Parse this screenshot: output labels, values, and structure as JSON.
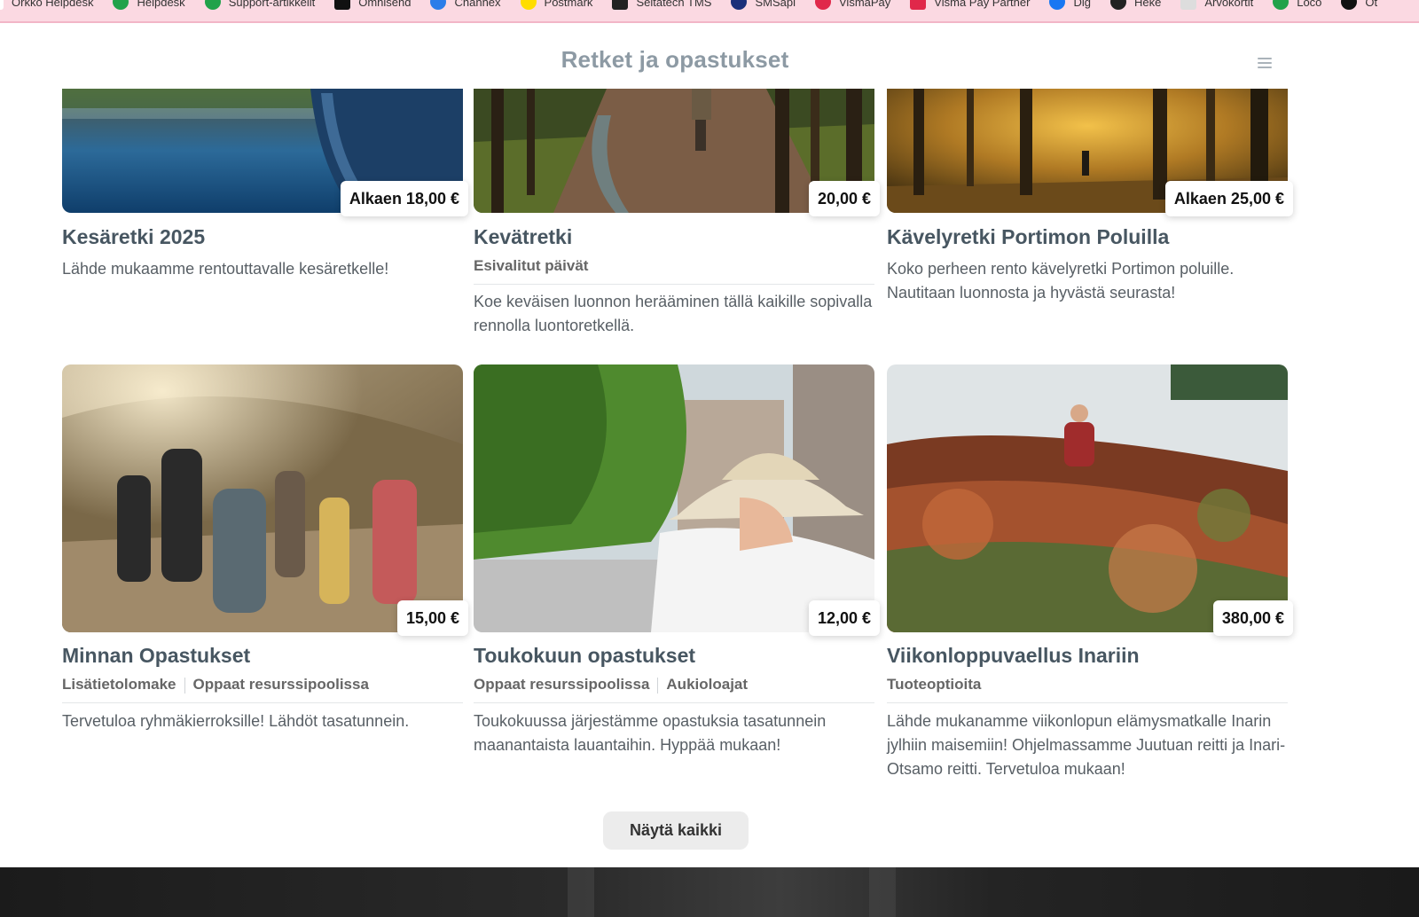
{
  "bookmarks": [
    {
      "label": "Orkko Helpdesk",
      "color": "#ffffff",
      "icon": "orkko-icon"
    },
    {
      "label": "Helpdesk",
      "color": "#21a24a",
      "icon": "helpdesk-icon"
    },
    {
      "label": "Support-artikkelit",
      "color": "#21a24a",
      "icon": "support-icon"
    },
    {
      "label": "Omnisend",
      "color": "#111111",
      "icon": "omnisend-icon"
    },
    {
      "label": "Channex",
      "color": "#2b7de9",
      "icon": "channex-icon"
    },
    {
      "label": "Postmark",
      "color": "#ffdd00",
      "icon": "postmark-icon"
    },
    {
      "label": "Seitatech TMS",
      "color": "#222222",
      "icon": "seitatech-icon"
    },
    {
      "label": "SMSapi",
      "color": "#1a2f7a",
      "icon": "smsapi-icon"
    },
    {
      "label": "VismaPay",
      "color": "#e0284a",
      "icon": "vismapay-icon"
    },
    {
      "label": "Visma Pay Partner",
      "color": "#e0284a",
      "icon": "vismapay-partner-icon"
    },
    {
      "label": "Dig",
      "color": "#1877f2",
      "icon": "dig-icon"
    },
    {
      "label": "Heke",
      "color": "#222222",
      "icon": "heke-icon"
    },
    {
      "label": "Arvokortit",
      "color": "#dddddd",
      "icon": "arvokortit-icon"
    },
    {
      "label": "Loco",
      "color": "#21a24a",
      "icon": "loco-icon"
    },
    {
      "label": "Ot",
      "color": "#111111",
      "icon": "ot-icon"
    }
  ],
  "header": {
    "title": "Retket ja opastukset"
  },
  "cards": [
    {
      "title": "Kesäretki 2025",
      "price": "Alkaen 18,00 €",
      "tags": [],
      "description": "Lähde mukaamme rentouttavalle kesäretkelle!"
    },
    {
      "title": "Kevätretki",
      "price": "20,00 €",
      "tags": [
        "Esivalitut päivät"
      ],
      "description": "Koe keväisen luonnon herääminen tällä kaikille sopivalla rennolla luontoretkellä."
    },
    {
      "title": "Kävelyretki Portimon Poluilla",
      "price": "Alkaen 25,00 €",
      "tags": [],
      "description": "Koko perheen rento kävelyretki Portimon poluille. Nautitaan luonnosta ja hyvästä seurasta!"
    },
    {
      "title": "Minnan Opastukset",
      "price": "15,00 €",
      "tags": [
        "Lisätietolomake",
        "Oppaat resurssipoolissa"
      ],
      "description": "Tervetuloa ryhmäkierroksille! Lähdöt tasatunnein."
    },
    {
      "title": "Toukokuun opastukset",
      "price": "12,00 €",
      "tags": [
        "Oppaat resurssipoolissa",
        "Aukioloajat"
      ],
      "description": "Toukokuussa järjestämme opastuksia tasatunnein maanantaista lauantaihin. Hyppää mukaan!"
    },
    {
      "title": "Viikonloppuvaellus Inariin",
      "price": "380,00 €",
      "tags": [
        "Tuoteoptioita"
      ],
      "description": "Lähde mukanamme viikonlopun elämysmatkalle Inarin jylhiin maisemiin! Ohjelmassamme Juutuan reitti ja Inari-Otsamo reitti. Tervetuloa mukaan!"
    }
  ],
  "actions": {
    "show_all": "Näytä kaikki"
  }
}
